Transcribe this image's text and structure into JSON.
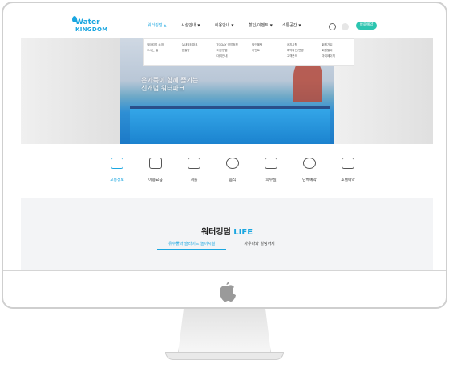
{
  "logo": {
    "top": "Water",
    "bottom": "KINGDOM"
  },
  "nav": {
    "items": [
      {
        "label": "워터킹덤",
        "caret": "▲"
      },
      {
        "label": "시설안내",
        "caret": "▼"
      },
      {
        "label": "이용안내",
        "caret": "▼"
      },
      {
        "label": "할인/이벤트",
        "caret": "▼"
      },
      {
        "label": "소통공간",
        "caret": "▼"
      }
    ],
    "reserve_label": "바로예약"
  },
  "mega_menu": {
    "col1": [
      "워터킹덤 소개",
      "오시는 길"
    ],
    "col2": [
      "실내워터파크",
      "찜질방"
    ],
    "col3": [
      "TODAY 영업정보",
      "이용방법",
      "대여안내"
    ],
    "col4": [
      "할인혜택",
      "이벤트"
    ],
    "col5": [
      "공지사항",
      "예약확인/변경",
      "고객문의"
    ],
    "col6": [
      "회원가입",
      "회원탈퇴",
      "마이페이지"
    ]
  },
  "hero": {
    "line1": "온가족이 함께 즐기는",
    "line2": "신개념 워터파크"
  },
  "quick": [
    {
      "label": "교통정보",
      "icon": "car-icon"
    },
    {
      "label": "이용요금",
      "icon": "card-icon"
    },
    {
      "label": "셔틀",
      "icon": "bus-icon"
    },
    {
      "label": "음식",
      "icon": "dining-icon"
    },
    {
      "label": "의무실",
      "icon": "medical-house-icon"
    },
    {
      "label": "단체예약",
      "icon": "group-icon"
    },
    {
      "label": "호텔예약",
      "icon": "calendar-icon"
    }
  ],
  "life": {
    "title_main": "워터킹덤",
    "title_accent": "LIFE",
    "tabs": [
      "유수풀과 슬라이드 놀이시설",
      "사우나와 힐링까지"
    ]
  },
  "colors": {
    "accent": "#1aa6e0",
    "reserve": "#2cc5b0"
  }
}
